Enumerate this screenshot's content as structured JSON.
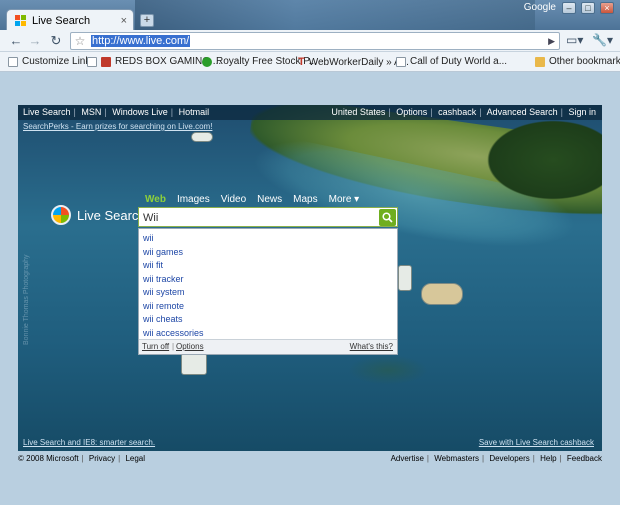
{
  "browser": {
    "tab_title": "Live Search",
    "tab_close": "×",
    "new_tab": "+",
    "brand": "Google",
    "url": "http://www.live.com/",
    "window_buttons": [
      "–",
      "□",
      "×"
    ]
  },
  "bookmarks": [
    {
      "label": "Customize Links",
      "icon": "page-icon",
      "color": "#ffffff"
    },
    {
      "label": "REDS BOX GAMING ...",
      "icon": "reds-icon",
      "color": "#c0392b"
    },
    {
      "label": "Royalty Free Stock P...",
      "icon": "stock-icon",
      "color": "#2a9d2a"
    },
    {
      "label": "WebWorkerDaily » A...",
      "icon": "t-icon",
      "color": "#c0392b"
    },
    {
      "label": "Call of Duty World a...",
      "icon": "page-icon",
      "color": "#ffffff"
    }
  ],
  "other_bookmarks": "Other bookmarks",
  "page": {
    "topnav_left": [
      "Live Search",
      "MSN",
      "Windows Live",
      "Hotmail"
    ],
    "topnav_right": [
      "United States",
      "Options",
      "cashback",
      "Advanced Search",
      "Sign in"
    ],
    "perks": "SearchPerks - Earn prizes for searching on Live.com!",
    "logo": "Live Search",
    "search_tabs": [
      "Web",
      "Images",
      "Video",
      "News",
      "Maps",
      "More ▾"
    ],
    "query": "Wii",
    "suggestions": [
      "wii",
      "wii games",
      "wii fit",
      "wii tracker",
      "wii system",
      "wii remote",
      "wii cheats",
      "wii accessories"
    ],
    "suggest_footer": {
      "turn_off": "Turn off",
      "options": "Options",
      "whats_this": "What's this?"
    },
    "bottom_left": "Live Search and IE8: smarter search.",
    "bottom_right": "Save with Live Search cashback",
    "credit": "Bonnie Thomas Photography"
  },
  "footer": {
    "copyright": "© 2008 Microsoft",
    "left_links": [
      "Privacy",
      "Legal"
    ],
    "right_links": [
      "Advertise",
      "Webmasters",
      "Developers",
      "Help",
      "Feedback"
    ]
  }
}
